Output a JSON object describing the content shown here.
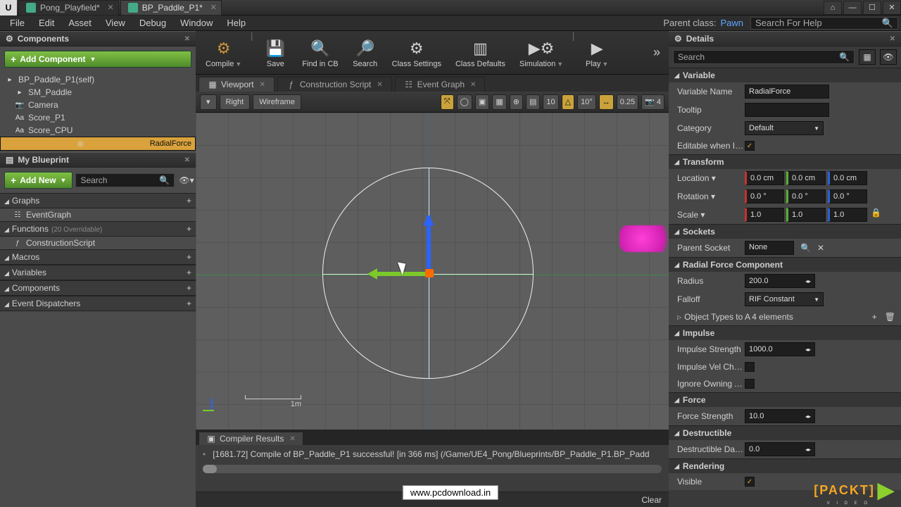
{
  "title_tabs": [
    "Pong_Playfield*",
    "BP_Paddle_P1*"
  ],
  "win_buttons": [
    "—",
    "☐",
    "✕"
  ],
  "menu": [
    "File",
    "Edit",
    "Asset",
    "View",
    "Debug",
    "Window",
    "Help"
  ],
  "parent_label": "Parent class:",
  "parent_class": "Pawn",
  "search_help": "Search For Help",
  "components": {
    "title": "Components",
    "add": "Add Component",
    "root": "BP_Paddle_P1(self)",
    "items": [
      {
        "icon": "▸",
        "label": "SM_Paddle"
      },
      {
        "icon": "📷",
        "label": "Camera"
      },
      {
        "icon": "Aa",
        "label": "Score_P1"
      },
      {
        "icon": "Aa",
        "label": "Score_CPU"
      },
      {
        "icon": "◎",
        "label": "RadialForce",
        "selected": true
      }
    ]
  },
  "my_blueprint": {
    "title": "My Blueprint",
    "add": "Add New",
    "search": "Search",
    "sections": [
      {
        "label": "Graphs",
        "items": [
          {
            "icon": "☷",
            "label": "EventGraph"
          }
        ]
      },
      {
        "label": "Functions",
        "note": "(20 Overridable)",
        "items": [
          {
            "icon": "ƒ",
            "label": "ConstructionScript"
          }
        ]
      },
      {
        "label": "Macros",
        "items": []
      },
      {
        "label": "Variables",
        "items": []
      },
      {
        "label": "Components",
        "items": []
      },
      {
        "label": "Event Dispatchers",
        "items": []
      }
    ]
  },
  "toolbar": [
    {
      "label": "Compile",
      "icon": "⚙"
    },
    {
      "label": "Save",
      "icon": "💾"
    },
    {
      "label": "Find in CB",
      "icon": "🔍"
    },
    {
      "label": "Search",
      "icon": "🔎"
    },
    {
      "label": "Class Settings",
      "icon": "⚙"
    },
    {
      "label": "Class Defaults",
      "icon": "▥"
    },
    {
      "label": "Simulation",
      "icon": "▶⚙"
    },
    {
      "label": "Play",
      "icon": "▶"
    }
  ],
  "viewport_tabs": [
    {
      "icon": "▦",
      "label": "Viewport"
    },
    {
      "icon": "ƒ",
      "label": "Construction Script"
    },
    {
      "icon": "☷",
      "label": "Event Graph"
    }
  ],
  "vp_toolbar": {
    "left": [
      {
        "t": "▾"
      },
      {
        "t": "Right",
        "dim": true
      },
      {
        "t": "Wireframe"
      }
    ],
    "right": [
      {
        "t": "⤧",
        "orange": true
      },
      {
        "t": "◯"
      },
      {
        "t": "▣"
      },
      {
        "t": "▦"
      },
      {
        "t": "⊕"
      },
      {
        "t": "▤"
      },
      {
        "t": "10"
      },
      {
        "t": "△",
        "orange": true
      },
      {
        "t": "10°"
      },
      {
        "t": "↔",
        "orange": true
      },
      {
        "t": "0.25"
      },
      {
        "t": "📷 4"
      }
    ]
  },
  "scale_label": "1m",
  "compiler": {
    "title": "Compiler Results",
    "line": "[1681.72] Compile of BP_Paddle_P1 successful! [in 366 ms] (/Game/UE4_Pong/Blueprints/BP_Paddle_P1.BP_Padd",
    "clear": "Clear"
  },
  "details": {
    "title": "Details",
    "search": "Search",
    "sections": [
      {
        "head": "Variable",
        "rows": [
          {
            "lbl": "Variable Name",
            "type": "txt",
            "val": "RadialForce"
          },
          {
            "lbl": "Tooltip",
            "type": "txt",
            "val": ""
          },
          {
            "lbl": "Category",
            "type": "sel",
            "val": "Default"
          },
          {
            "lbl": "Editable when Inhe",
            "type": "chk",
            "val": true
          }
        ]
      },
      {
        "head": "Transform",
        "rows": [
          {
            "lbl": "Location ▾",
            "type": "vec",
            "v": [
              "0.0 cm",
              "0.0 cm",
              "0.0 cm"
            ]
          },
          {
            "lbl": "Rotation ▾",
            "type": "vec",
            "v": [
              "0.0 °",
              "0.0 °",
              "0.0 °"
            ]
          },
          {
            "lbl": "Scale ▾",
            "type": "vec",
            "v": [
              "1.0",
              "1.0",
              "1.0"
            ],
            "lock": true
          }
        ]
      },
      {
        "head": "Sockets",
        "rows": [
          {
            "lbl": "Parent Socket",
            "type": "socket",
            "val": "None"
          }
        ]
      },
      {
        "head": "Radial Force Component",
        "rows": [
          {
            "lbl": "Radius",
            "type": "spin",
            "val": "200.0"
          },
          {
            "lbl": "Falloff",
            "type": "sel",
            "val": "RIF Constant"
          },
          {
            "lbl": "Object Types to A",
            "type": "arr",
            "val": "4 elements",
            "tri": true
          }
        ]
      },
      {
        "head": "Impulse",
        "rows": [
          {
            "lbl": "Impulse Strength",
            "type": "spin",
            "val": "1000.0"
          },
          {
            "lbl": "Impulse Vel Chang",
            "type": "chk",
            "val": false
          },
          {
            "lbl": "Ignore Owning Act",
            "type": "chk",
            "val": false
          }
        ]
      },
      {
        "head": "Force",
        "rows": [
          {
            "lbl": "Force Strength",
            "type": "spin",
            "val": "10.0"
          }
        ]
      },
      {
        "head": "Destructible",
        "rows": [
          {
            "lbl": "Destructible Dama",
            "type": "spin",
            "val": "0.0"
          }
        ]
      },
      {
        "head": "Rendering",
        "rows": [
          {
            "lbl": "Visible",
            "type": "chk",
            "val": true
          }
        ]
      }
    ]
  },
  "watermark": "www.pcdownload.in",
  "packt": "PACKT"
}
